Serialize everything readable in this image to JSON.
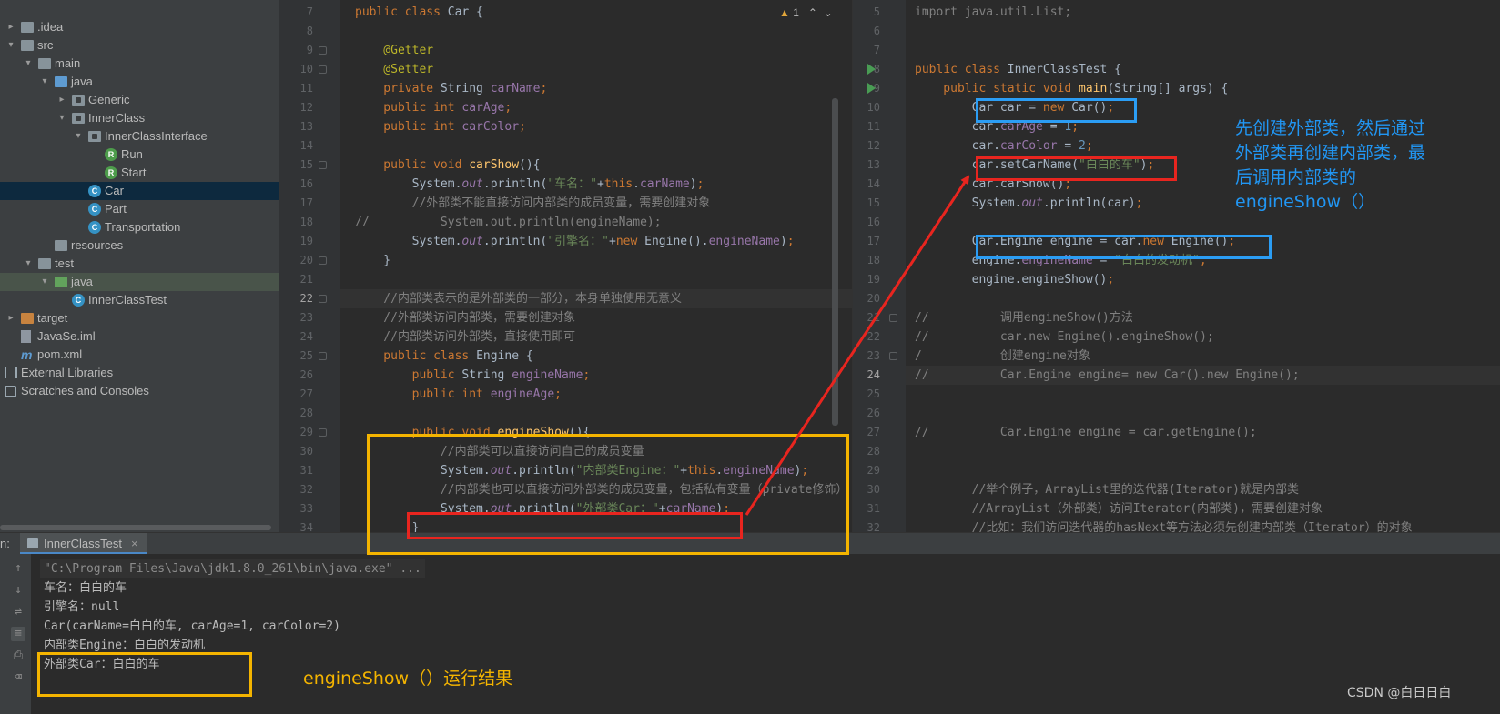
{
  "tree": {
    "items": [
      {
        "label": ".idea",
        "kind": "folder"
      },
      {
        "label": "src",
        "kind": "folder"
      },
      {
        "label": "main",
        "kind": "folder"
      },
      {
        "label": "java",
        "kind": "folder-blue"
      },
      {
        "label": "Generic",
        "kind": "package"
      },
      {
        "label": "InnerClass",
        "kind": "package"
      },
      {
        "label": "InnerClassInterface",
        "kind": "package"
      },
      {
        "label": "Run",
        "kind": "class-run"
      },
      {
        "label": "Start",
        "kind": "class-run"
      },
      {
        "label": "Car",
        "kind": "class"
      },
      {
        "label": "Part",
        "kind": "class"
      },
      {
        "label": "Transportation",
        "kind": "class"
      },
      {
        "label": "resources",
        "kind": "folder-res"
      },
      {
        "label": "test",
        "kind": "folder"
      },
      {
        "label": "java",
        "kind": "folder-green"
      },
      {
        "label": "InnerClassTest",
        "kind": "class"
      },
      {
        "label": "target",
        "kind": "folder-orange"
      },
      {
        "label": "JavaSe.iml",
        "kind": "file"
      },
      {
        "label": "pom.xml",
        "kind": "maven"
      },
      {
        "label": "External Libraries",
        "kind": "libs"
      },
      {
        "label": "Scratches and Consoles",
        "kind": "scratches"
      }
    ]
  },
  "editor_left": {
    "warning_count": "1",
    "line_numbers": [
      "7",
      "8",
      "9",
      "10",
      "11",
      "12",
      "13",
      "14",
      "15",
      "16",
      "17",
      "18",
      "19",
      "20",
      "21",
      "22",
      "23",
      "24",
      "25",
      "26",
      "27",
      "28",
      "29",
      "30",
      "31",
      "32",
      "33",
      "34"
    ],
    "current_line": "22",
    "lines": [
      [
        [
          "k",
          "public class "
        ],
        [
          "pl",
          "Car {"
        ]
      ],
      [],
      [
        [
          "a",
          "    @Getter"
        ]
      ],
      [
        [
          "a",
          "    @Setter"
        ]
      ],
      [
        [
          "k",
          "    private "
        ],
        [
          "pl",
          "String "
        ],
        [
          "f",
          "carName"
        ],
        [
          "k",
          ";"
        ]
      ],
      [
        [
          "k",
          "    public int "
        ],
        [
          "f",
          "carAge"
        ],
        [
          "k",
          ";"
        ]
      ],
      [
        [
          "k",
          "    public int "
        ],
        [
          "f",
          "carColor"
        ],
        [
          "k",
          ";"
        ]
      ],
      [],
      [
        [
          "k",
          "    public void "
        ],
        [
          "m",
          "carShow"
        ],
        [
          "pl",
          "(){"
        ]
      ],
      [
        [
          "pl",
          "        System."
        ],
        [
          "fi",
          "out"
        ],
        [
          "pl",
          ".println("
        ],
        [
          "s",
          "\"车名：\""
        ],
        [
          "pl",
          "+"
        ],
        [
          "k",
          "this"
        ],
        [
          "pl",
          "."
        ],
        [
          "f",
          "carName"
        ],
        [
          "pl",
          ")"
        ],
        [
          "k",
          ";"
        ]
      ],
      [
        [
          "c",
          "        //外部类不能直接访问内部类的成员变量，需要创建对象"
        ]
      ],
      [
        [
          "c",
          "//          System.out.println(engineName);"
        ]
      ],
      [
        [
          "pl",
          "        System."
        ],
        [
          "fi",
          "out"
        ],
        [
          "pl",
          ".println("
        ],
        [
          "s",
          "\"引擎名：\""
        ],
        [
          "pl",
          "+"
        ],
        [
          "k",
          "new "
        ],
        [
          "pl",
          "Engine()."
        ],
        [
          "f",
          "engineName"
        ],
        [
          "pl",
          ")"
        ],
        [
          "k",
          ";"
        ]
      ],
      [
        [
          "pl",
          "    }"
        ]
      ],
      [],
      [
        [
          "c",
          "    //内部类表示的是外部类的一部分，本身单独使用无意义"
        ]
      ],
      [
        [
          "c",
          "    //外部类访问内部类，需要创建对象"
        ]
      ],
      [
        [
          "c",
          "    //内部类访问外部类，直接使用即可"
        ]
      ],
      [
        [
          "k",
          "    public class "
        ],
        [
          "pl",
          "Engine {"
        ]
      ],
      [
        [
          "k",
          "        public "
        ],
        [
          "pl",
          "String "
        ],
        [
          "f",
          "engineName"
        ],
        [
          "k",
          ";"
        ]
      ],
      [
        [
          "k",
          "        public int "
        ],
        [
          "f",
          "engineAge"
        ],
        [
          "k",
          ";"
        ]
      ],
      [],
      [
        [
          "k",
          "        public void "
        ],
        [
          "m",
          "engineShow"
        ],
        [
          "pl",
          "(){"
        ]
      ],
      [
        [
          "c",
          "            //内部类可以直接访问自己的成员变量"
        ]
      ],
      [
        [
          "pl",
          "            System."
        ],
        [
          "fi",
          "out"
        ],
        [
          "pl",
          ".println("
        ],
        [
          "s",
          "\"内部类Engine：\""
        ],
        [
          "pl",
          "+"
        ],
        [
          "k",
          "this"
        ],
        [
          "pl",
          "."
        ],
        [
          "f",
          "engineName"
        ],
        [
          "pl",
          ")"
        ],
        [
          "k",
          ";"
        ]
      ],
      [
        [
          "c",
          "            //内部类也可以直接访问外部类的成员变量，包括私有变量（private修饰）"
        ]
      ],
      [
        [
          "pl",
          "            System."
        ],
        [
          "fi",
          "out"
        ],
        [
          "pl",
          ".println("
        ],
        [
          "s",
          "\"外部类Car：\""
        ],
        [
          "pl",
          "+"
        ],
        [
          "f",
          "carName"
        ],
        [
          "pl",
          ")"
        ],
        [
          "k",
          ";"
        ]
      ],
      [
        [
          "pl",
          "        }"
        ]
      ]
    ]
  },
  "editor_right": {
    "line_numbers": [
      "5",
      "6",
      "7",
      "8",
      "9",
      "10",
      "11",
      "12",
      "13",
      "14",
      "15",
      "16",
      "17",
      "18",
      "19",
      "20",
      "21",
      "22",
      "23",
      "24",
      "25",
      "26",
      "27",
      "28",
      "29",
      "30",
      "31",
      "32"
    ],
    "current_line": "24",
    "lines": [
      [
        [
          "c",
          "import java.util.List;"
        ]
      ],
      [],
      [],
      [
        [
          "k",
          "public class "
        ],
        [
          "pl",
          "InnerClassTest {"
        ]
      ],
      [
        [
          "k",
          "    public static void "
        ],
        [
          "m",
          "main"
        ],
        [
          "pl",
          "(String[] args) {"
        ]
      ],
      [
        [
          "pl",
          "        Car car = "
        ],
        [
          "k",
          "new "
        ],
        [
          "pl",
          "Car()"
        ],
        [
          "k",
          ";"
        ]
      ],
      [
        [
          "pl",
          "        car."
        ],
        [
          "f",
          "carAge"
        ],
        [
          "pl",
          " = "
        ],
        [
          "n",
          "1"
        ],
        [
          "k",
          ";"
        ]
      ],
      [
        [
          "pl",
          "        car."
        ],
        [
          "f",
          "carColor"
        ],
        [
          "pl",
          " = "
        ],
        [
          "n",
          "2"
        ],
        [
          "k",
          ";"
        ]
      ],
      [
        [
          "pl",
          "        car.setCarName("
        ],
        [
          "s",
          "\"白白的车\""
        ],
        [
          "pl",
          ")"
        ],
        [
          "k",
          ";"
        ]
      ],
      [
        [
          "pl",
          "        car.carShow()"
        ],
        [
          "k",
          ";"
        ]
      ],
      [
        [
          "pl",
          "        System."
        ],
        [
          "fi",
          "out"
        ],
        [
          "pl",
          ".println(car)"
        ],
        [
          "k",
          ";"
        ]
      ],
      [],
      [
        [
          "pl",
          "        Car.Engine engine = car."
        ],
        [
          "k",
          "new "
        ],
        [
          "pl",
          "Engine()"
        ],
        [
          "k",
          ";"
        ]
      ],
      [
        [
          "pl",
          "        engine."
        ],
        [
          "f",
          "engineName"
        ],
        [
          "pl",
          " = "
        ],
        [
          "s",
          "\"白白的发动机\""
        ],
        [
          "k",
          ";"
        ]
      ],
      [
        [
          "pl",
          "        engine.engineShow()"
        ],
        [
          "k",
          ";"
        ]
      ],
      [],
      [
        [
          "c",
          "//          调用engineShow()方法"
        ]
      ],
      [
        [
          "c",
          "//          car.new Engine().engineShow();"
        ]
      ],
      [
        [
          "c",
          "/           创建engine对象"
        ]
      ],
      [
        [
          "c",
          "//          Car.Engine engine= new Car().new Engine();"
        ]
      ],
      [],
      [],
      [
        [
          "c",
          "//          Car.Engine engine = car.getEngine();"
        ]
      ],
      [],
      [],
      [
        [
          "c",
          "        //举个例子，ArrayList里的迭代器(Iterator)就是内部类"
        ]
      ],
      [
        [
          "c",
          "        //ArrayList（外部类）访问Iterator(内部类)，需要创建对象"
        ]
      ],
      [
        [
          "c",
          "        //比如：我们访问迭代器的hasNext等方法必须先创建内部类（Iterator）的对象"
        ]
      ]
    ]
  },
  "run": {
    "label": "n:",
    "tab_label": "InnerClassTest",
    "output": [
      "\"C:\\Program Files\\Java\\jdk1.8.0_261\\bin\\java.exe\" ...",
      "车名：白白的车",
      "引擎名：null",
      "Car(carName=白白的车, carAge=1, carColor=2)",
      "内部类Engine：白白的发动机",
      "外部类Car：白白的车"
    ]
  },
  "annotations": {
    "note_right": "先创建外部类，然后通过外部类再创建内部类，最后调用内部类的engineShow（）",
    "note_bottom": "engineShow（）运行结果",
    "watermark": "CSDN @白日日白"
  },
  "colors": {
    "blue_box": "#2b9df4",
    "red_box": "#e8251f",
    "yellow_box": "#f4b400"
  }
}
